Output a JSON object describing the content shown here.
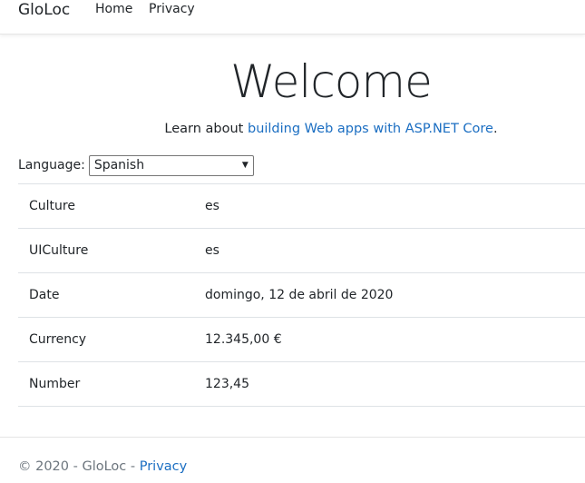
{
  "navbar": {
    "brand": "GloLoc",
    "links": [
      "Home",
      "Privacy"
    ]
  },
  "main": {
    "title": "Welcome",
    "learn_prefix": "Learn about ",
    "learn_link": "building Web apps with ASP.NET Core",
    "learn_suffix": "."
  },
  "language": {
    "label": "Language:",
    "selected": "Spanish"
  },
  "table": {
    "rows": [
      {
        "key": "Culture",
        "value": "es"
      },
      {
        "key": "UICulture",
        "value": "es"
      },
      {
        "key": "Date",
        "value": "domingo, 12 de abril de 2020"
      },
      {
        "key": "Currency",
        "value": "12.345,00 €"
      },
      {
        "key": "Number",
        "value": "123,45"
      }
    ]
  },
  "footer": {
    "text": "© 2020 - GloLoc - ",
    "link": "Privacy"
  },
  "colors": {
    "link": "#1b6ec2",
    "border": "#dee2e6",
    "text": "#212529"
  }
}
